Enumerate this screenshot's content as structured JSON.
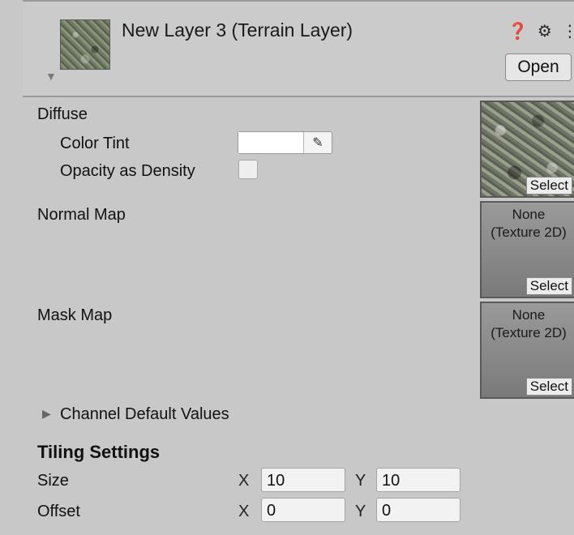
{
  "header": {
    "title": "New Layer 3 (Terrain Layer)",
    "open_label": "Open",
    "icons": [
      "help-icon",
      "settings-sliders-icon",
      "more-menu-icon"
    ]
  },
  "diffuse": {
    "label": "Diffuse",
    "color_tint_label": "Color Tint",
    "color_tint_value": "#FFFFFF",
    "opacity_label": "Opacity as Density",
    "opacity_checked": false,
    "select_label": "Select"
  },
  "normal_map": {
    "label": "Normal Map",
    "texture_text_1": "None",
    "texture_text_2": "(Texture 2D)",
    "select_label": "Select"
  },
  "mask_map": {
    "label": "Mask Map",
    "texture_text_1": "None",
    "texture_text_2": "(Texture 2D)",
    "select_label": "Select"
  },
  "channel_defaults": {
    "label": "Channel Default Values",
    "expanded": false
  },
  "tiling": {
    "heading": "Tiling Settings",
    "size_label": "Size",
    "offset_label": "Offset",
    "x_label": "X",
    "y_label": "Y",
    "size_x": "10",
    "size_y": "10",
    "offset_x": "0",
    "offset_y": "0"
  }
}
